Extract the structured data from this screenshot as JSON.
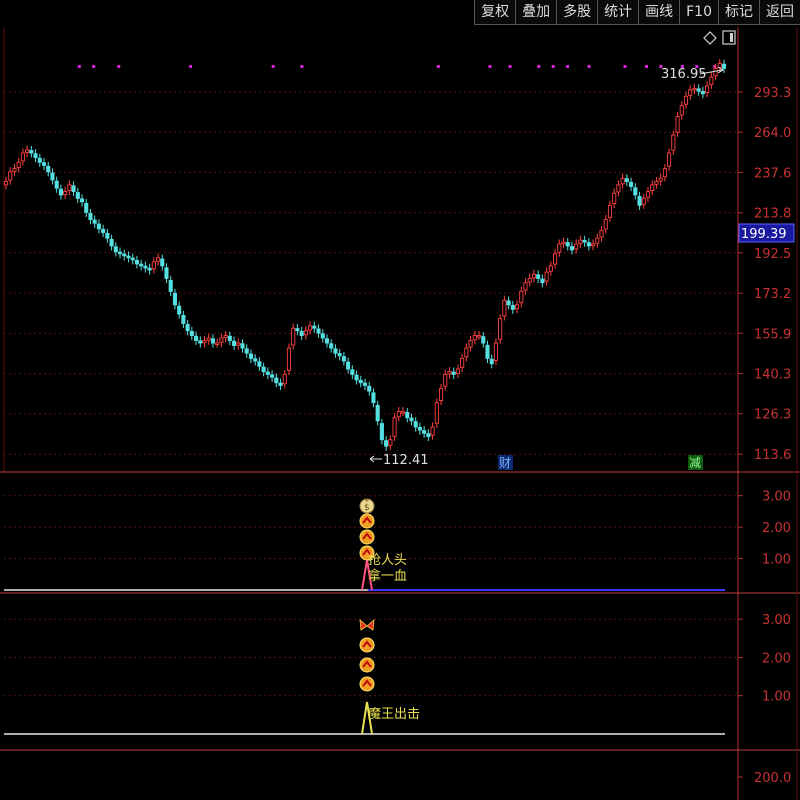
{
  "toolbar": {
    "buttons": [
      "复权",
      "叠加",
      "多股",
      "统计",
      "画线",
      "F10",
      "标记",
      "返回"
    ]
  },
  "colors": {
    "up": "#ff4040",
    "down": "#54e0e0",
    "grid": "#5a1010",
    "axis": "#b03030",
    "tick_text": "#c83232",
    "signal_dot": "#e020e0",
    "current_price_bg": "#1a1aa0",
    "panel_text": "#e8e050"
  },
  "icons": {
    "diamond": "diamond-icon",
    "window": "window-toggle-icon",
    "money_bag": "money-bag-icon",
    "arrow_up_circle": "up-arrow-circle-icon",
    "butterfly": "butterfly-icon"
  },
  "main_panel": {
    "max_label": "316.95",
    "min_label": "112.41",
    "current_price": "199.39",
    "event_badges": [
      "财",
      "减"
    ]
  },
  "panel2": {
    "labels": [
      "抢人头",
      "拿一血"
    ]
  },
  "panel3": {
    "labels": [
      "魔王出击"
    ]
  },
  "chart_data": [
    {
      "type": "candlestick",
      "title": "",
      "y_ticks": [
        113.6,
        126.3,
        140.3,
        155.9,
        173.2,
        192.5,
        213.8,
        237.6,
        264.0,
        293.3
      ],
      "ylim": [
        109,
        345
      ],
      "y_scale": "log",
      "grid": true,
      "close_series": [
        232,
        238,
        240,
        244,
        250,
        252,
        250,
        247,
        244,
        242,
        238,
        233,
        228,
        224,
        226,
        230,
        226,
        222,
        220,
        214,
        210,
        208,
        205,
        203,
        200,
        196,
        193,
        192,
        191,
        190,
        189,
        187,
        186,
        185,
        184,
        188,
        190,
        186,
        180,
        174,
        168,
        164,
        160,
        157,
        155,
        153,
        152,
        153,
        154,
        152,
        152,
        154,
        155,
        153,
        151,
        152,
        150,
        148,
        146,
        145,
        143,
        141,
        140,
        139,
        137,
        136,
        140,
        150,
        158,
        157,
        155,
        157,
        159,
        158,
        156,
        154,
        152,
        150,
        148,
        147,
        145,
        142,
        140,
        138,
        137,
        136,
        134,
        130,
        124,
        118,
        116,
        118,
        125,
        127,
        127,
        125,
        124,
        122,
        121,
        120,
        119,
        122,
        130,
        135,
        140,
        141,
        140,
        142,
        146,
        150,
        153,
        155,
        155,
        152,
        146,
        144,
        152,
        162,
        170,
        168,
        166,
        168,
        174,
        178,
        180,
        182,
        180,
        178,
        183,
        186,
        192,
        197,
        198,
        196,
        194,
        197,
        199,
        198,
        196,
        197,
        200,
        204,
        210,
        218,
        225,
        230,
        234,
        232,
        229,
        224,
        218,
        222,
        226,
        230,
        232,
        234,
        240,
        250,
        262,
        275,
        283,
        290,
        295,
        296,
        294,
        292,
        298,
        305,
        312,
        316,
        312
      ]
    },
    {
      "type": "signal",
      "title": "",
      "y_ticks": [
        1.0,
        2.0,
        3.0
      ],
      "ylim": [
        0,
        3.5
      ],
      "markers": [
        "money-bag",
        "arrow-up",
        "arrow-up",
        "arrow-up"
      ],
      "labels": [
        "抢人头",
        "拿一血"
      ]
    },
    {
      "type": "signal",
      "title": "",
      "y_ticks": [
        1.0,
        2.0,
        3.0
      ],
      "ylim": [
        0,
        3.5
      ],
      "markers": [
        "butterfly",
        "arrow-up",
        "arrow-up",
        "arrow-up"
      ],
      "labels": [
        "魔王出击"
      ]
    },
    {
      "type": "volume",
      "title": "",
      "y_ticks": [
        200.0
      ]
    }
  ]
}
